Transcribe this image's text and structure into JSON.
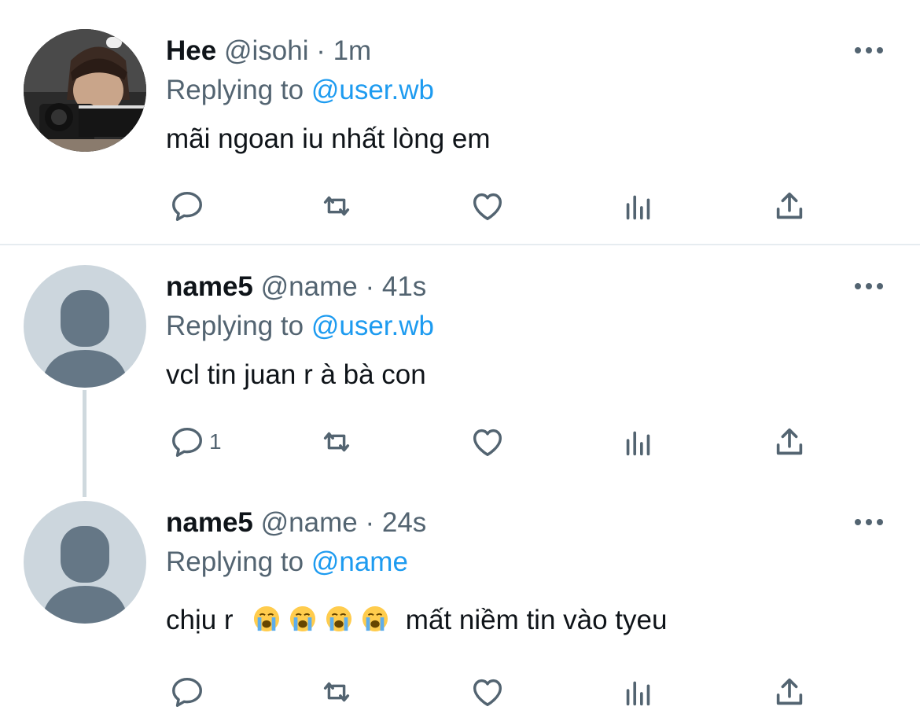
{
  "tweets": [
    {
      "display_name": "Hee",
      "handle": "@isohi",
      "separator": "·",
      "time": "1m",
      "reply_prefix": "Replying to",
      "reply_to": "@user.wb",
      "text": "mãi ngoan iu nhất lòng em",
      "reply_count": "",
      "avatar": "photo"
    },
    {
      "display_name": "name5",
      "handle": "@name",
      "separator": "·",
      "time": "41s",
      "reply_prefix": "Replying to",
      "reply_to": "@user.wb",
      "text": "vcl tin juan r à bà con",
      "reply_count": "1",
      "avatar": "default"
    },
    {
      "display_name": "name5",
      "handle": "@name",
      "separator": "·",
      "time": "24s",
      "reply_prefix": "Replying to",
      "reply_to": "@name",
      "text_before": "chịu r",
      "emojis": [
        "loudly-crying-face",
        "loudly-crying-face",
        "loudly-crying-face",
        "loudly-crying-face"
      ],
      "text_after": "mất niềm tin vào tyeu",
      "reply_count": "",
      "avatar": "default"
    }
  ],
  "icons": {
    "reply": "reply-icon",
    "retweet": "retweet-icon",
    "like": "heart-icon",
    "views": "analytics-icon",
    "share": "share-icon",
    "more": "more-icon"
  },
  "colors": {
    "link": "#1d9bf0",
    "muted": "#536471",
    "text": "#0f1419",
    "avatar_default_bg": "#ccd6dd",
    "avatar_default_fg": "#657786"
  }
}
